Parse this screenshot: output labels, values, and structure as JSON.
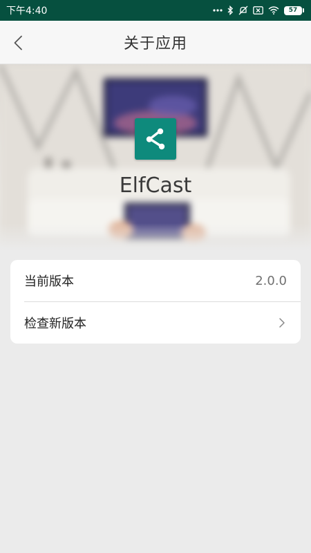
{
  "status_bar": {
    "time": "下午4:40",
    "battery": "57",
    "icons": [
      "more-dots-icon",
      "bluetooth-icon",
      "silent-icon",
      "sim-off-icon",
      "wifi-icon",
      "battery-icon"
    ]
  },
  "header": {
    "title": "关于应用",
    "back_icon": "back-chevron-icon"
  },
  "hero": {
    "app_name": "ElfCast",
    "logo_icon": "share-icon",
    "logo_color": "#0e8a7c"
  },
  "info": {
    "version_label": "当前版本",
    "version_value": "2.0.0",
    "check_label": "检查新版本"
  },
  "colors": {
    "status_bar": "#06503f",
    "accent": "#0e8a7c",
    "page_background": "#ebebeb"
  }
}
